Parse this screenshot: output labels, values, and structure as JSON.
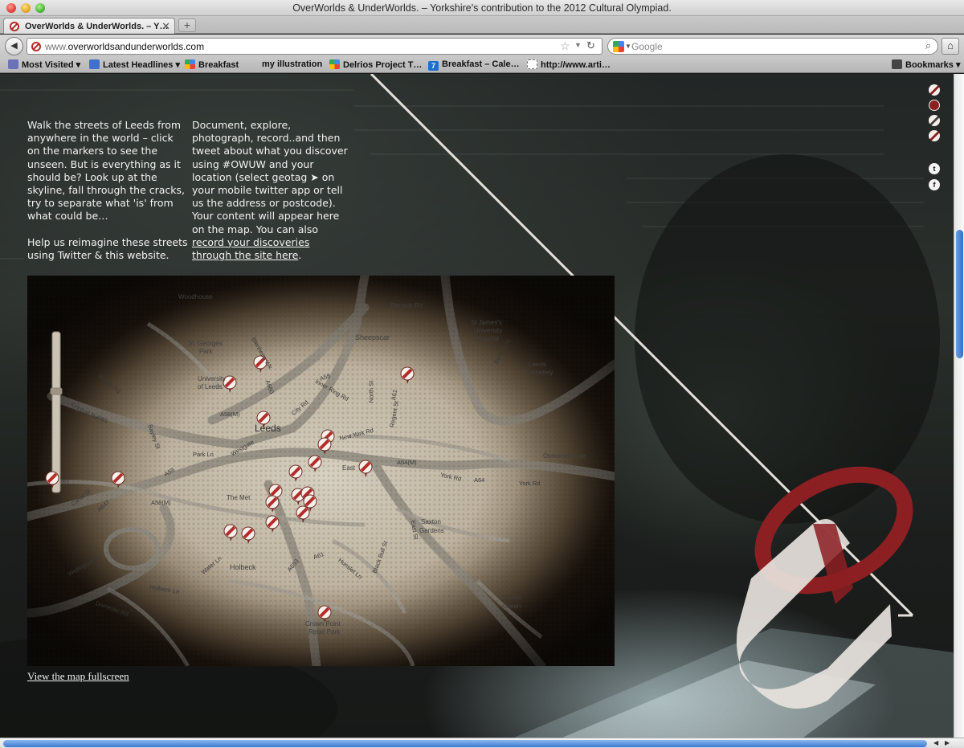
{
  "window": {
    "title": "OverWorlds & UnderWorlds. – Yorkshire's contribution to the 2012 Cultural Olympiad."
  },
  "tabs": [
    {
      "label": "OverWorlds & UnderWorlds. – Y…"
    }
  ],
  "toolbar": {
    "url_prefix": "www.",
    "url_domain": "overworldsandunderworlds.com",
    "search_placeholder": "Google"
  },
  "bookmarks": [
    {
      "label": "Most Visited",
      "icon": "folder-icon",
      "dropdown": "▾"
    },
    {
      "label": "Latest Headlines",
      "icon": "rss-icon",
      "dropdown": "▾"
    },
    {
      "label": "Breakfast",
      "icon": "google-icon"
    },
    {
      "label": "my illustration",
      "icon": "none"
    },
    {
      "label": "Delrios Project T…",
      "icon": "google-icon"
    },
    {
      "label": "Breakfast – Cale…",
      "icon": "calendar-7-icon"
    },
    {
      "label": "http://www.arti…",
      "icon": "blank-page-icon"
    },
    {
      "label": "Bookmarks",
      "icon": "bookmarks-icon",
      "dropdown": "▾"
    }
  ],
  "intro": {
    "left_p1": "Walk the streets of Leeds from anywhere in the world – click on the markers to see the unseen. But is everything as it should be? Look up at the skyline, fall through the cracks, try to separate what 'is' from what could be…",
    "left_p2": "Help us reimagine these streets using Twitter & this website.",
    "right_before_link": "Document, explore, photograph, record..and then tweet about what you discover using #OWUW and your location (select geotag ➤ on your mobile twitter app or tell us the address or postcode). Your content will appear here on the map. You can also ",
    "right_link": "record your discoveries through the site here",
    "right_after_link": "."
  },
  "map": {
    "labels": {
      "woodhouse": "Woodhouse",
      "barrack_rd": "Barrack Rd",
      "sheepscar": "Sheepscar",
      "st_georges": "St. Georges",
      "park": "Park",
      "university_of": "University",
      "of_leeds": "of Leeds",
      "st_james": "St James's",
      "university2": "University",
      "hospital": "Hospital",
      "h": "H",
      "leeds_cemetery1": "Leeds",
      "leeds_cemetery2": "Cemetery",
      "leeds": "Leeds",
      "burley_rd": "Burley Rd",
      "kirkstall_rd": "Kirkstall Rd",
      "a65": "A65",
      "bayley_st": "Bayley St",
      "park_ln": "Park Ln",
      "westgate": "Westgate",
      "a58m": "A58(M)",
      "a58m_2": "A58(M)",
      "a58": "A58",
      "a58_2": "A58",
      "a660": "A660",
      "city_rd": "City Rd",
      "inner_ring_rd": "Inner Ring Rd",
      "new_york_rd": "New York Rd",
      "a64m": "A64(M)",
      "york_rd": "York Rd",
      "a64": "A64",
      "york_rd_2": "York Rd",
      "osmondthorpe": "Osmondthorpe",
      "canal_st": "Canal St",
      "a647": "A647",
      "the_met": "The Met",
      "saxton": "Saxton",
      "gardens": "Gardens",
      "holbeck": "Holbeck",
      "wellington_rd": "Wellington Rd",
      "water_ln": "Water Ln",
      "holbeck_ln": "Holbeck Ln",
      "domestic_rd": "Domestic Rd",
      "a653": "A653",
      "a61": "A61",
      "hunslet_ln": "Hunslet Ln",
      "black_bull_st": "Black Bull St",
      "east_st": "East St",
      "cross": "Cross",
      "green": "Green",
      "crown_point": "Crown Point",
      "retail_park": "Retail Park",
      "north_st": "North St",
      "regent_st": "Regent St",
      "a61_2": "A61",
      "blenheim_wk": "Blenheim Wk",
      "armley_ley": "ley",
      "becket_st": "Beckett St",
      "easte": "East"
    }
  },
  "links": {
    "fullscreen": "View the map fullscreen"
  },
  "social": {
    "twitter": "t",
    "facebook": "f"
  },
  "colors": {
    "brand_red": "#8c1f22",
    "letter_cream": "#e7e2dc",
    "marker_red": "#b32c2a"
  }
}
